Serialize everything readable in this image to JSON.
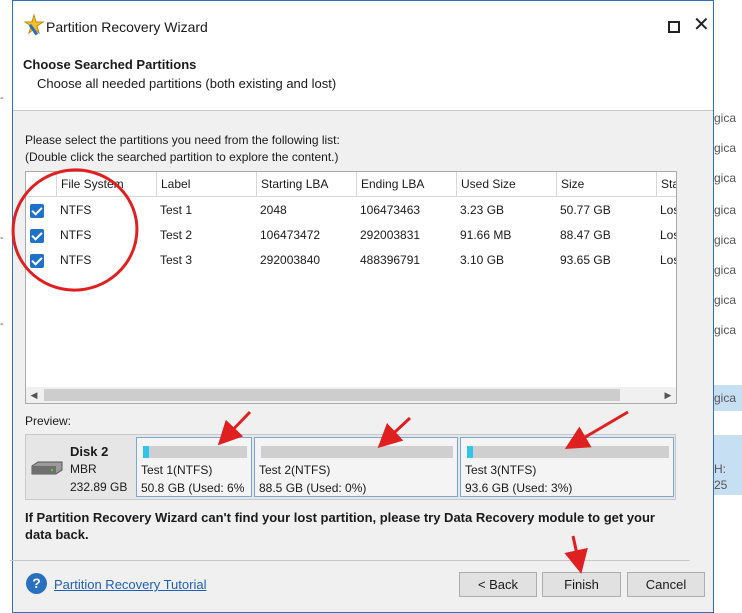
{
  "window": {
    "title": "Partition Recovery Wizard"
  },
  "header": {
    "title": "Choose Searched Partitions",
    "subtitle": "Choose all needed partitions (both existing and lost)"
  },
  "instructions": {
    "line1": "Please select the partitions you need from the following list:",
    "line2": "(Double click the searched partition to explore the content.)"
  },
  "table": {
    "columns": [
      "File System",
      "Label",
      "Starting LBA",
      "Ending LBA",
      "Used Size",
      "Size",
      "Sta"
    ],
    "rows": [
      {
        "checked": true,
        "fs": "NTFS",
        "label": "Test 1",
        "start": "2048",
        "end": "106473463",
        "used": "3.23 GB",
        "size": "50.77 GB",
        "status": "Los"
      },
      {
        "checked": true,
        "fs": "NTFS",
        "label": "Test 2",
        "start": "106473472",
        "end": "292003831",
        "used": "91.66 MB",
        "size": "88.47 GB",
        "status": "Los"
      },
      {
        "checked": true,
        "fs": "NTFS",
        "label": "Test 3",
        "start": "292003840",
        "end": "488396791",
        "used": "3.10 GB",
        "size": "93.65 GB",
        "status": "Los"
      }
    ]
  },
  "preview": {
    "label": "Preview:",
    "disk": {
      "name": "Disk 2",
      "type": "MBR",
      "size": "232.89 GB"
    },
    "partitions": [
      {
        "name": "Test 1(NTFS)",
        "info": "50.8 GB (Used: 6%",
        "used_fraction": 0.06
      },
      {
        "name": "Test 2(NTFS)",
        "info": "88.5 GB (Used: 0%)",
        "used_fraction": 0.0
      },
      {
        "name": "Test 3(NTFS)",
        "info": "93.6 GB (Used: 3%)",
        "used_fraction": 0.03
      }
    ]
  },
  "note": "If Partition Recovery Wizard can't find your lost partition, please try Data Recovery module to get your data back.",
  "footer": {
    "tutorial": "Partition Recovery Tutorial",
    "back": "< Back",
    "finish": "Finish",
    "cancel": "Cancel"
  },
  "background": {
    "items": [
      "gica",
      "gica",
      "gica",
      "gica",
      "gica",
      "gica",
      "gica",
      "gica",
      "gica"
    ],
    "side_items": [
      "H:",
      "25"
    ]
  },
  "colors": {
    "accent": "#1e72c9",
    "annotation": "#e02020",
    "usage_fill": "#2fc4ea"
  }
}
